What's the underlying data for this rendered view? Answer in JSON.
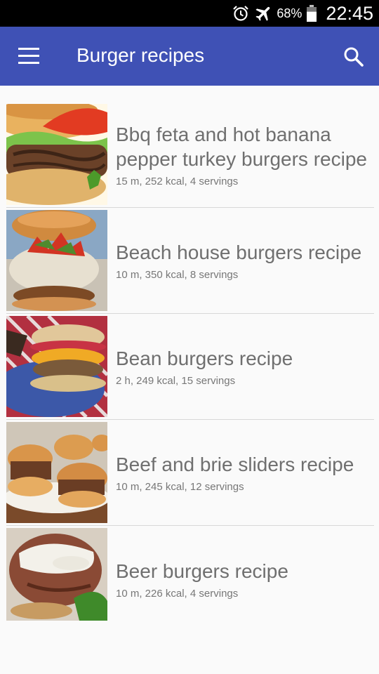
{
  "status": {
    "battery": "68%",
    "time": "22:45"
  },
  "appbar": {
    "title": "Burger recipes"
  },
  "recipes": [
    {
      "title": "Bbq feta and hot banana pepper turkey burgers recipe",
      "meta": "15 m, 252 kcal, 4 servings"
    },
    {
      "title": "Beach house burgers recipe",
      "meta": "10 m, 350 kcal, 8 servings"
    },
    {
      "title": "Bean burgers recipe",
      "meta": "2 h, 249 kcal, 15 servings"
    },
    {
      "title": "Beef and brie sliders recipe",
      "meta": "10 m, 245 kcal, 12 servings"
    },
    {
      "title": "Beer burgers recipe",
      "meta": "10 m, 226 kcal, 4 servings"
    }
  ]
}
